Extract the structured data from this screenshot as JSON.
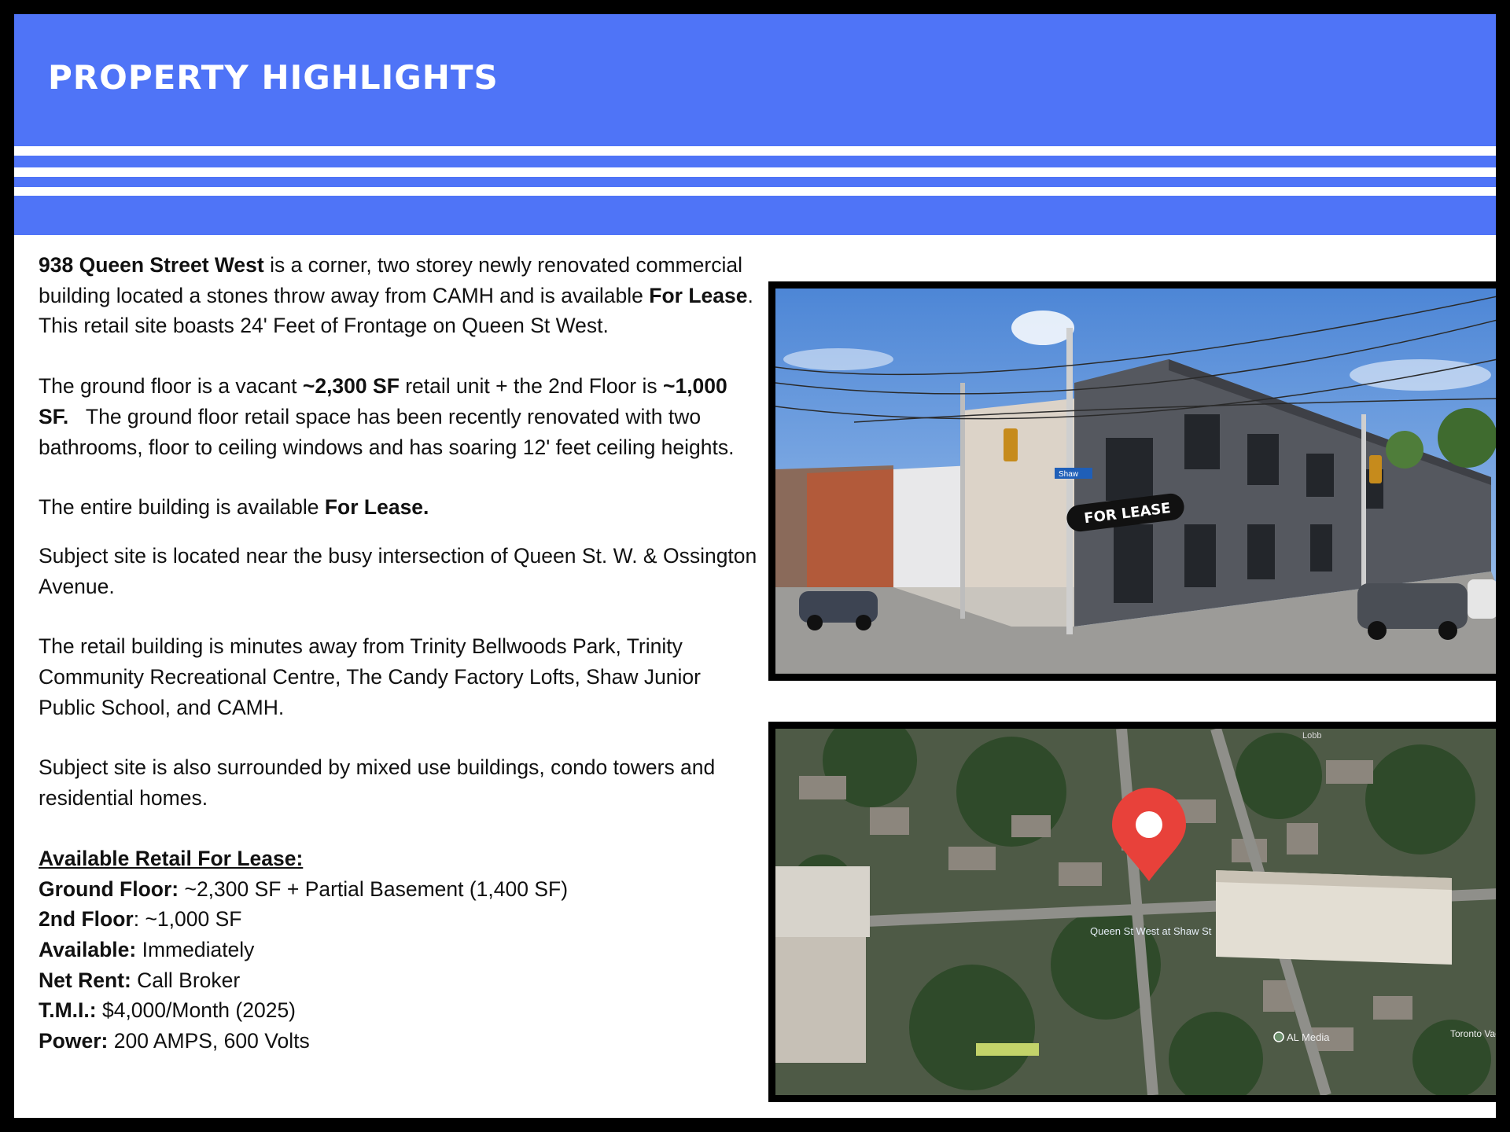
{
  "header": {
    "title": "PROPERTY HIGHLIGHTS"
  },
  "intro": {
    "address": "938 Queen Street West",
    "text_1": " is a corner, two storey newly renovated commercial building located a stones throw away from CAMH and is available ",
    "for_lease": "For Lease",
    "text_2": ".  This retail site boasts 24' Feet of Frontage on Queen St West."
  },
  "ground_floor": {
    "text_1": "The ground floor is a vacant ",
    "retail_sf": "~2,300 SF",
    "text_2": " retail unit + the 2nd Floor is ",
    "second_sf": "~1,000 SF.",
    "text_3": "   The ground floor retail space has been recently renovated with two bathrooms, floor to ceiling windows and has soaring 12' feet ceiling heights."
  },
  "entire": {
    "text": "The entire building is available ",
    "bold": "For Lease."
  },
  "intersection": "Subject site is located near the busy intersection of Queen St. W. & Ossington Avenue.",
  "nearby": "The retail building is minutes away from Trinity Bellwoods Park, Trinity Community Recreational Centre, The Candy Factory Lofts, Shaw Junior Public School, and CAMH.",
  "surroundings": "Subject site is also surrounded by mixed use buildings, condo towers and residential homes.",
  "lease_details": {
    "heading": "Available Retail For Lease:",
    "rows": [
      {
        "label": "Ground Floor:",
        "value": " ~2,300 SF + Partial Basement (1,400 SF)"
      },
      {
        "label": "2nd Floor",
        "value": ": ~1,000 SF"
      },
      {
        "label": "Available:",
        "value": " Immediately"
      },
      {
        "label": "Net Rent:",
        "value": " Call Broker"
      },
      {
        "label": "T.M.I.:",
        "value": " $4,000/Month (2025)"
      },
      {
        "label": "Power:",
        "value": " 200 AMPS, 600 Volts"
      }
    ]
  },
  "photo": {
    "sign_text": "FOR LEASE",
    "street_sign": "Shaw"
  },
  "map": {
    "labels": {
      "intersection": "Queen St West at Shaw St",
      "business": "AL Media",
      "corner": "Toronto Vacati",
      "street": "Lobb"
    }
  },
  "colors": {
    "banner_blue": "#4f74f7",
    "frame": "#000000",
    "pin_red": "#e8413a"
  }
}
